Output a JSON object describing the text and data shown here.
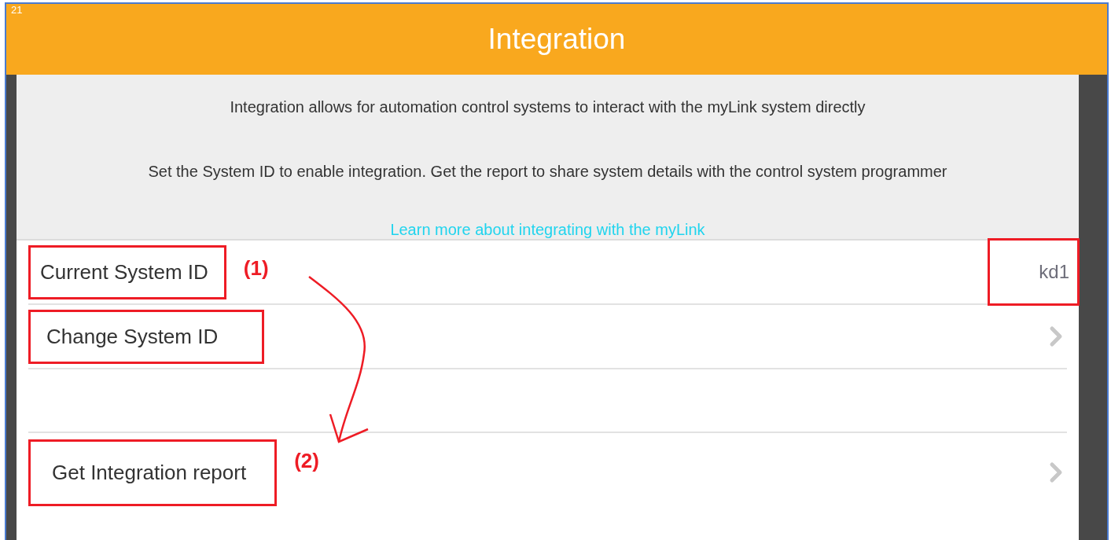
{
  "status_text": "21",
  "header": {
    "title": "Integration"
  },
  "intro": {
    "paragraphs": [
      "Integration allows for automation control systems to interact with the myLink system directly",
      "Set the System ID to enable integration. Get the report to share system details with the control system programmer"
    ],
    "link": "Learn more about integrating with the myLink"
  },
  "sections": [
    {
      "rows": [
        {
          "kind": "value",
          "label": "Current System ID",
          "label_highlighted": true,
          "marker": "(1)",
          "value": "kd1",
          "value_highlighted": true
        },
        {
          "kind": "nav",
          "label": "Change System ID",
          "label_highlighted": true
        }
      ]
    },
    {
      "rows": [
        {
          "kind": "nav",
          "label": "Get Integration report",
          "label_highlighted": true,
          "marker": "(2)"
        }
      ]
    }
  ]
}
